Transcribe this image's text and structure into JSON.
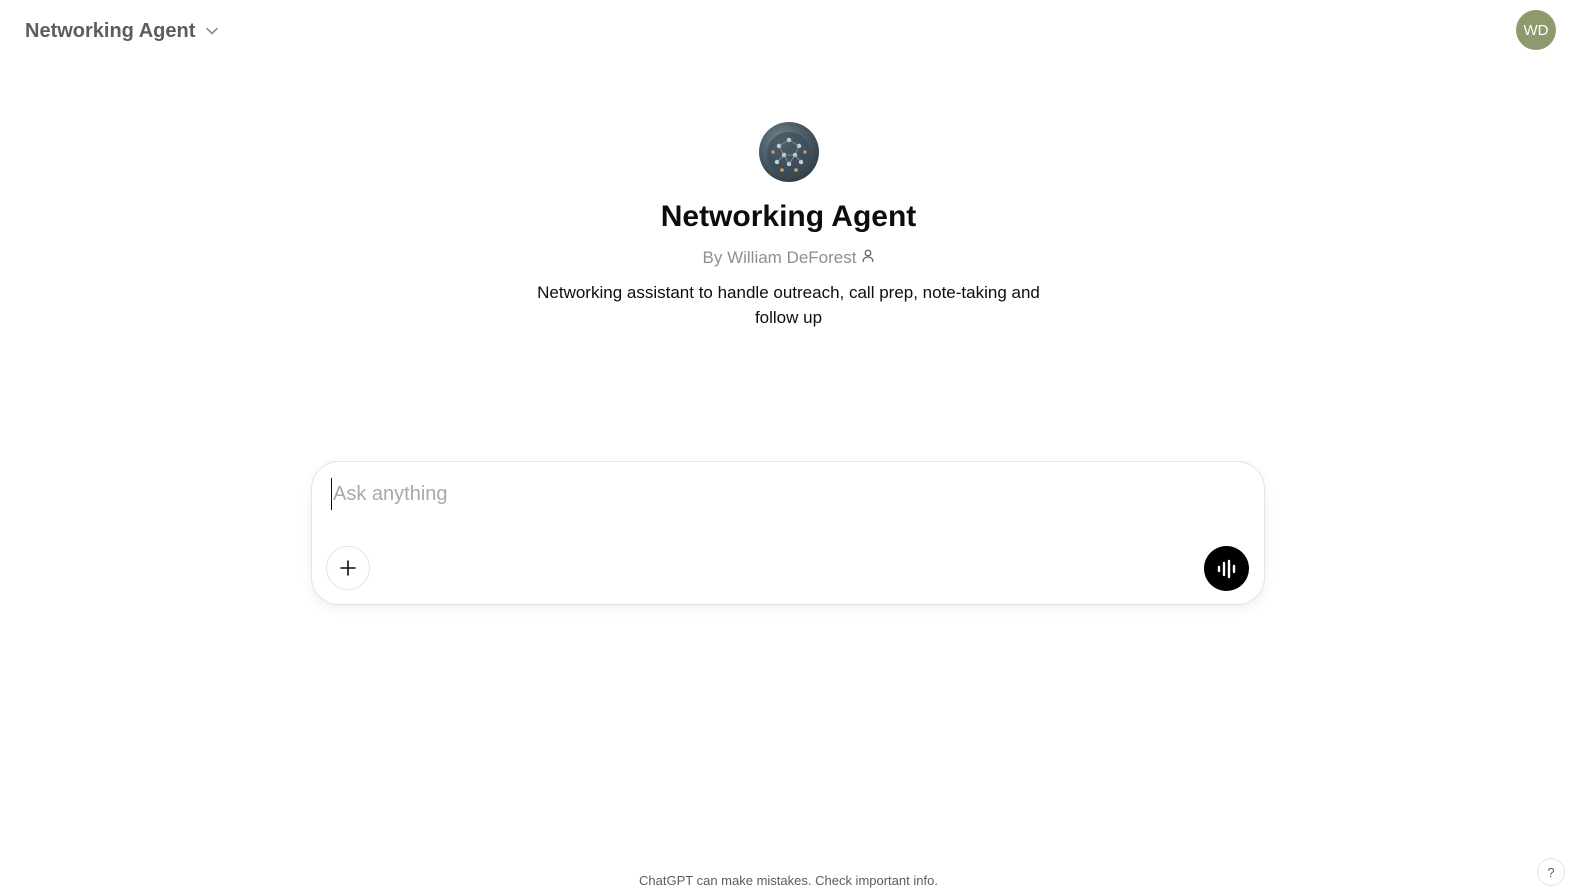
{
  "header": {
    "model_name": "Networking Agent",
    "user_initials": "WD",
    "avatar_color": "#8c9a6e"
  },
  "gpt": {
    "title": "Networking Agent",
    "author": "By William DeForest",
    "description": "Networking assistant to handle outreach, call prep, note-taking and follow up"
  },
  "composer": {
    "placeholder": "Ask anything",
    "value": ""
  },
  "footer": {
    "disclaimer": "ChatGPT can make mistakes. Check important info.",
    "help_label": "?"
  }
}
